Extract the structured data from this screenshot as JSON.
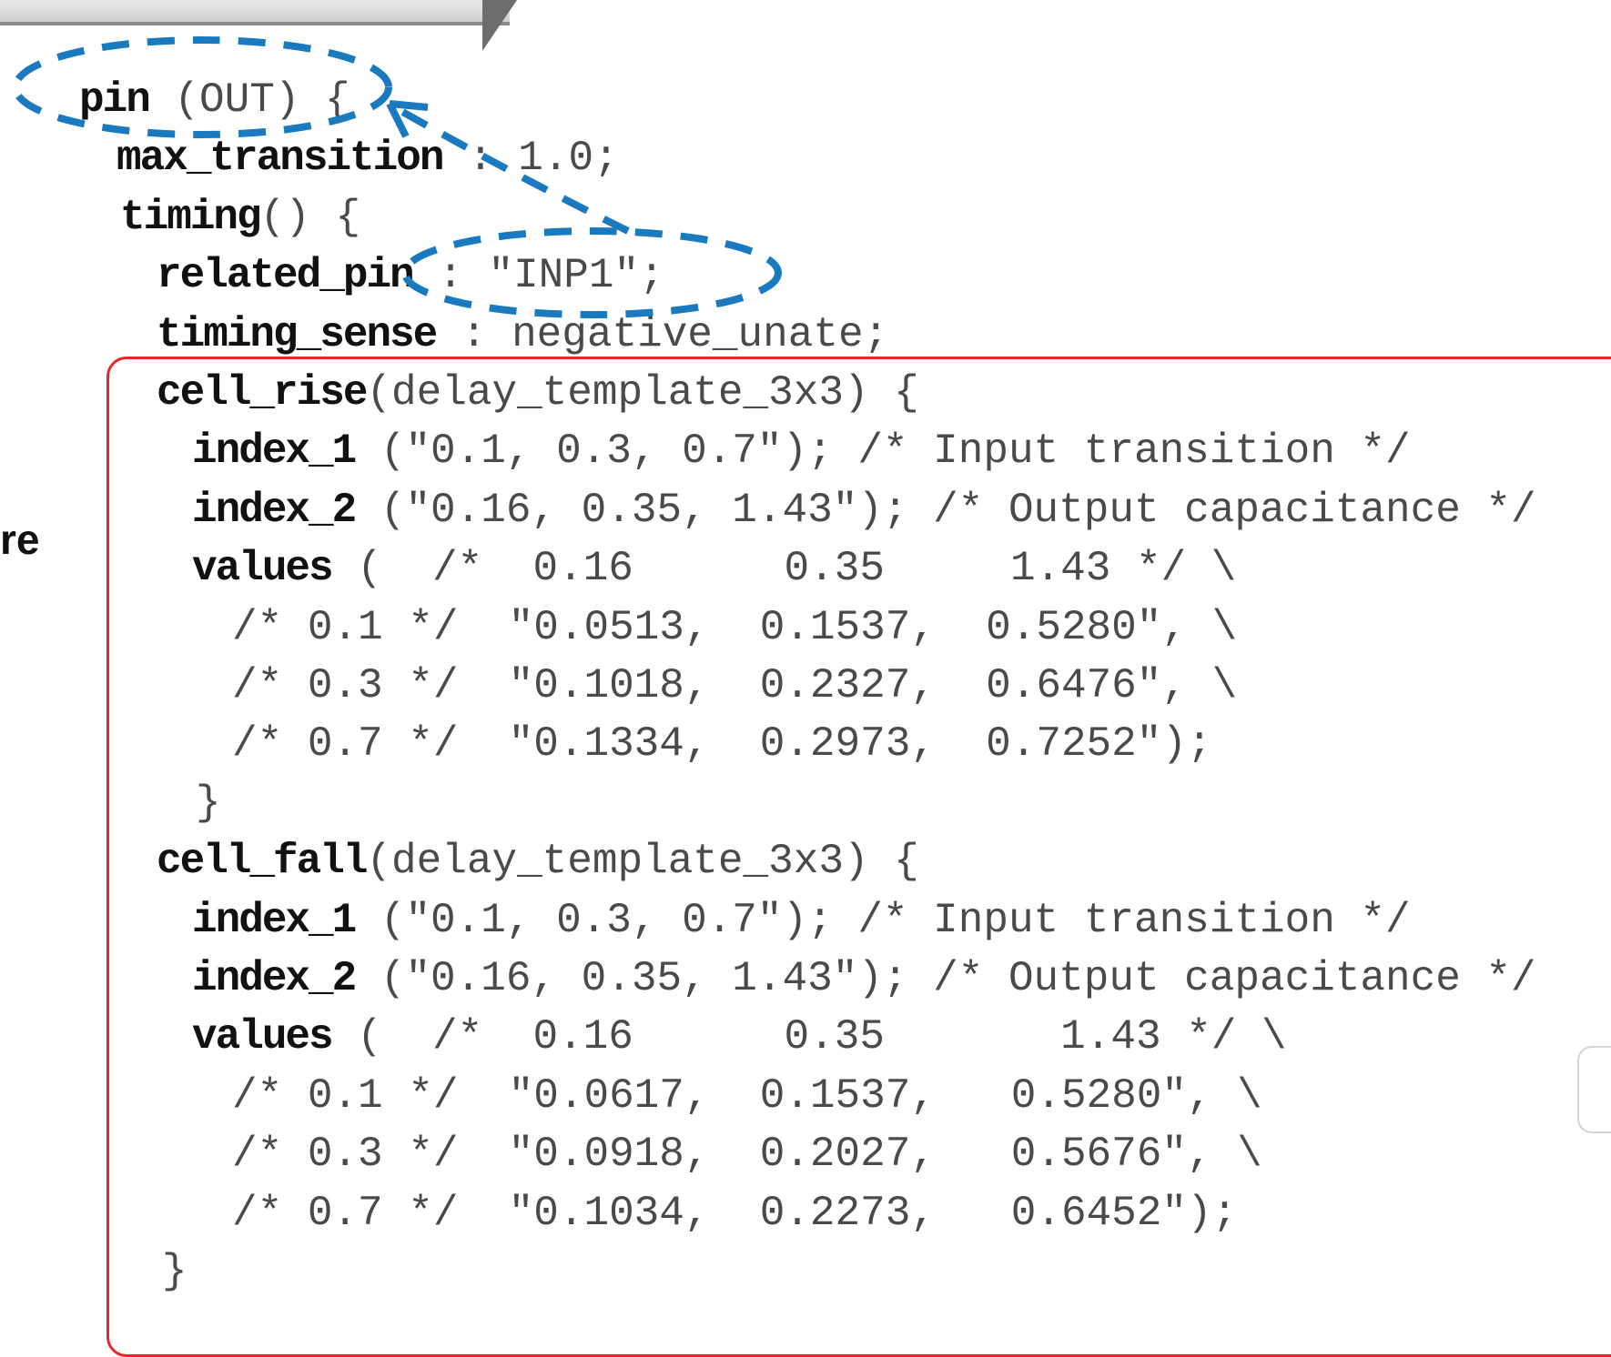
{
  "slide": {
    "side_text": "re",
    "annotation_color": "#1a7abf",
    "highlight_box_color": "#e8262b",
    "code_lines": [
      [
        {
          "t": "pin",
          "kw": true
        },
        {
          "t": " (OUT) {"
        }
      ],
      [
        {
          "t": "max_transition",
          "kw": true
        },
        {
          "t": " : 1.0;"
        }
      ],
      [
        {
          "t": "timing",
          "kw": true
        },
        {
          "t": "() {"
        }
      ],
      [
        {
          "t": "related_pin",
          "kw": true
        },
        {
          "t": " : \"INP1\";"
        }
      ],
      [
        {
          "t": "timing_sense",
          "kw": true
        },
        {
          "t": " : negative_unate;"
        }
      ],
      [
        {
          "t": "cell_rise",
          "kw": true
        },
        {
          "t": "(delay_template_3x3) {"
        }
      ],
      [
        {
          "t": "index_1",
          "kw": true
        },
        {
          "t": " (\"0.1, 0.3, 0.7\"); /* Input transition */"
        }
      ],
      [
        {
          "t": "index_2",
          "kw": true
        },
        {
          "t": " (\"0.16, 0.35, 1.43\"); /* Output capacitance */"
        }
      ],
      [
        {
          "t": "values",
          "kw": true
        },
        {
          "t": " (  /*  0.16      0.35     1.43 */ \\"
        }
      ],
      [
        {
          "t": "/* 0.1 */  \"0.0513,  0.1537,  0.5280\", \\"
        }
      ],
      [
        {
          "t": "/* 0.3 */  \"0.1018,  0.2327,  0.6476\", \\"
        }
      ],
      [
        {
          "t": "/* 0.7 */  \"0.1334,  0.2973,  0.7252\");"
        }
      ],
      [
        {
          "t": "}"
        }
      ],
      [
        {
          "t": "cell_fall",
          "kw": true
        },
        {
          "t": "(delay_template_3x3) {"
        }
      ],
      [
        {
          "t": "index_1",
          "kw": true
        },
        {
          "t": " (\"0.1, 0.3, 0.7\"); /* Input transition */"
        }
      ],
      [
        {
          "t": "index_2",
          "kw": true
        },
        {
          "t": " (\"0.16, 0.35, 1.43\"); /* Output capacitance */"
        }
      ],
      [
        {
          "t": "values",
          "kw": true
        },
        {
          "t": " (  /*  0.16      0.35       1.43 */ \\"
        }
      ],
      [
        {
          "t": "/* 0.1 */  \"0.0617,  0.1537,   0.5280\", \\"
        }
      ],
      [
        {
          "t": "/* 0.3 */  \"0.0918,  0.2027,   0.5676\", \\"
        }
      ],
      [
        {
          "t": "/* 0.7 */  \"0.1034,  0.2273,   0.6452\");"
        }
      ],
      [
        {
          "t": "}"
        }
      ]
    ]
  }
}
